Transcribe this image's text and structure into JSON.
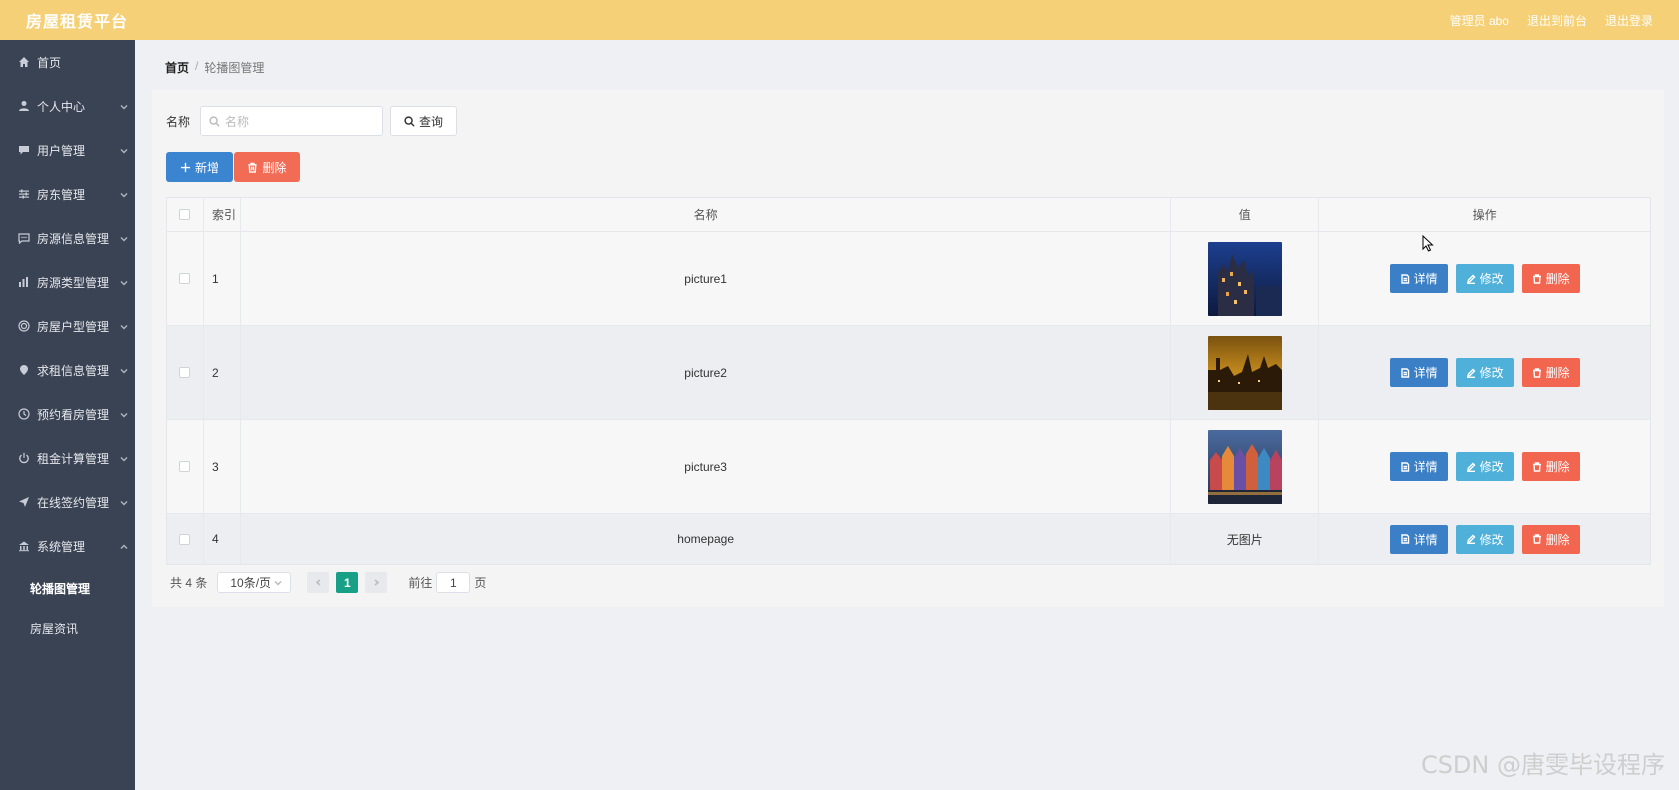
{
  "header": {
    "brand": "房屋租赁平台",
    "admin_label": "管理员 abo",
    "back_to_front": "退出到前台",
    "logout": "退出登录"
  },
  "sidebar": {
    "items": [
      {
        "label": "首页",
        "icon": "home-icon",
        "expandable": false
      },
      {
        "label": "个人中心",
        "icon": "user-icon",
        "expandable": true
      },
      {
        "label": "用户管理",
        "icon": "chat-icon",
        "expandable": true
      },
      {
        "label": "房东管理",
        "icon": "sliders-icon",
        "expandable": true
      },
      {
        "label": "房源信息管理",
        "icon": "message-icon",
        "expandable": true
      },
      {
        "label": "房源类型管理",
        "icon": "bar-chart-icon",
        "expandable": true
      },
      {
        "label": "房屋户型管理",
        "icon": "target-icon",
        "expandable": true
      },
      {
        "label": "求租信息管理",
        "icon": "location-icon",
        "expandable": true
      },
      {
        "label": "预约看房管理",
        "icon": "clock-icon",
        "expandable": true
      },
      {
        "label": "租金计算管理",
        "icon": "power-icon",
        "expandable": true
      },
      {
        "label": "在线签约管理",
        "icon": "send-icon",
        "expandable": true
      },
      {
        "label": "系统管理",
        "icon": "bank-icon",
        "expandable": true
      }
    ],
    "subitems": [
      {
        "label": "轮播图管理",
        "active": true
      },
      {
        "label": "房屋资讯",
        "active": false
      }
    ]
  },
  "breadcrumb": {
    "home": "首页",
    "separator": "/",
    "current": "轮播图管理"
  },
  "search": {
    "label": "名称",
    "placeholder": "名称",
    "query_button": "查询"
  },
  "actions": {
    "add": "新增",
    "delete": "删除"
  },
  "table": {
    "headers": {
      "index": "索引",
      "name": "名称",
      "value": "值",
      "ops": "操作"
    },
    "rows": [
      {
        "index": "1",
        "name": "picture1",
        "value": "",
        "image": "night-castle"
      },
      {
        "index": "2",
        "name": "picture2",
        "value": "",
        "image": "golden-city"
      },
      {
        "index": "3",
        "name": "picture3",
        "value": "",
        "image": "colorful-houses"
      },
      {
        "index": "4",
        "name": "homepage",
        "value": "无图片",
        "image": null
      }
    ],
    "ops": {
      "detail": "详情",
      "edit": "修改",
      "delete": "删除"
    }
  },
  "pagination": {
    "total": "共 4 条",
    "page_size": "10条/页",
    "current_page": "1",
    "goto_label": "前往",
    "goto_value": "1",
    "page_unit": "页"
  },
  "watermark": "CSDN @唐雯毕设程序",
  "colors": {
    "topbar": "#f6d076",
    "sidebar": "#3a4354",
    "primary": "#3a84d0",
    "danger": "#f26b55",
    "info": "#4fb1da",
    "page_active": "#17a085"
  }
}
